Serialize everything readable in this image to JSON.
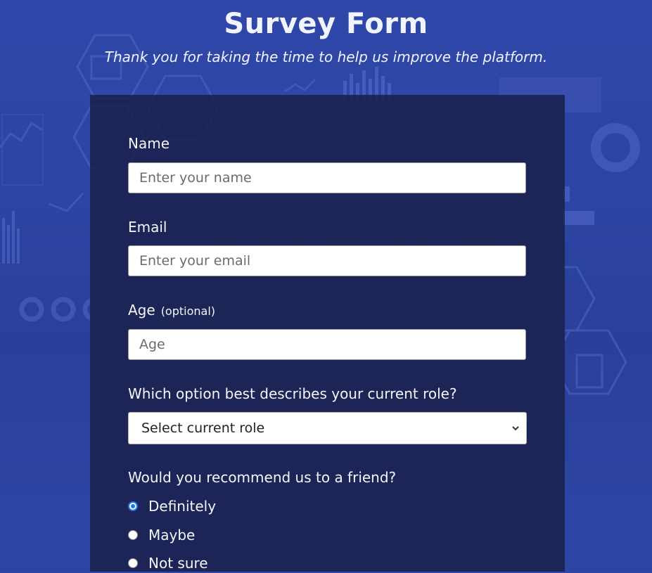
{
  "page": {
    "title": "Survey Form",
    "subtitle": "Thank you for taking the time to help us improve the platform."
  },
  "form": {
    "name": {
      "label": "Name",
      "placeholder": "Enter your name",
      "value": ""
    },
    "email": {
      "label": "Email",
      "placeholder": "Enter your email",
      "value": ""
    },
    "age": {
      "label": "Age",
      "optional_text": "(optional)",
      "placeholder": "Age",
      "value": ""
    },
    "role": {
      "label": "Which option best describes your current role?",
      "selected": "Select current role"
    },
    "recommend": {
      "label": "Would you recommend us to a friend?",
      "options": [
        "Definitely",
        "Maybe",
        "Not sure"
      ],
      "selected": "Definitely"
    }
  },
  "colors": {
    "background": "#2d45a4",
    "card": "#1b204a",
    "radio_accent": "#1a73e8"
  }
}
